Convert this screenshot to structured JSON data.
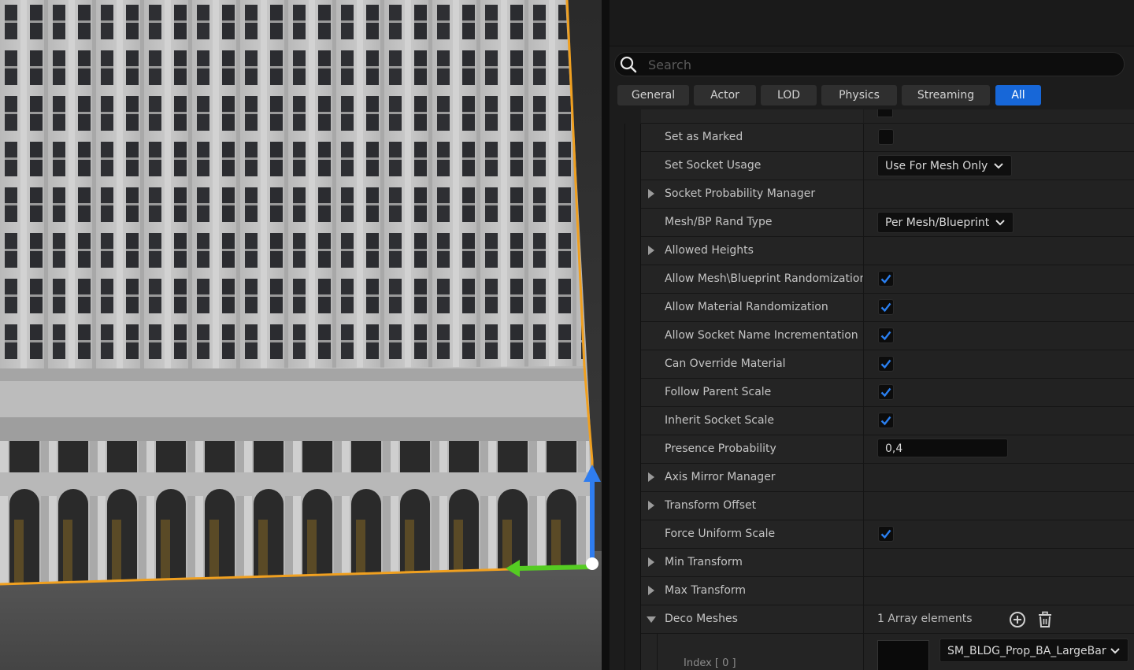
{
  "search": {
    "placeholder": "Search"
  },
  "tabs": [
    {
      "label": "General",
      "active": false
    },
    {
      "label": "Actor",
      "active": false
    },
    {
      "label": "LOD",
      "active": false
    },
    {
      "label": "Physics",
      "active": false
    },
    {
      "label": "Streaming",
      "active": false
    },
    {
      "label": "All",
      "active": true
    }
  ],
  "properties": {
    "set_as_marked": {
      "label": "Set as Marked",
      "checked": false
    },
    "set_socket_usage": {
      "label": "Set Socket Usage",
      "value": "Use For Mesh Only"
    },
    "socket_probability_manager": {
      "label": "Socket Probability Manager"
    },
    "mesh_bp_rand_type": {
      "label": "Mesh/BP Rand Type",
      "value": "Per Mesh/Blueprint"
    },
    "allowed_heights": {
      "label": "Allowed Heights"
    },
    "allow_mesh_bp_randomization": {
      "label": "Allow Mesh\\Blueprint Randomization",
      "checked": true
    },
    "allow_material_randomization": {
      "label": "Allow Material Randomization",
      "checked": true
    },
    "allow_socket_name_incrementation": {
      "label": "Allow Socket Name Incrementation",
      "checked": true
    },
    "can_override_material": {
      "label": "Can Override Material",
      "checked": true
    },
    "follow_parent_scale": {
      "label": "Follow Parent Scale",
      "checked": true
    },
    "inherit_socket_scale": {
      "label": "Inherit Socket Scale",
      "checked": true
    },
    "presence_probability": {
      "label": "Presence Probability",
      "value": "0,4"
    },
    "axis_mirror_manager": {
      "label": "Axis Mirror Manager"
    },
    "transform_offset": {
      "label": "Transform Offset"
    },
    "force_uniform_scale": {
      "label": "Force Uniform Scale",
      "checked": true
    },
    "min_transform": {
      "label": "Min Transform"
    },
    "max_transform": {
      "label": "Max Transform"
    },
    "deco_meshes": {
      "label": "Deco Meshes",
      "value": "1 Array elements"
    },
    "deco_mesh_0": {
      "index_label": "Index [ 0 ]",
      "value": "SM_BLDG_Prop_BA_LargeBar"
    }
  },
  "icons": {
    "search": "magnifier-icon",
    "add": "plus-circle-icon",
    "delete": "trash-icon",
    "dropdown": "chevron-down-icon",
    "expand": "triangle-right-icon",
    "collapse": "triangle-down-icon",
    "checkbox": "checkmark-icon"
  },
  "colors": {
    "accent": "#1767d8",
    "selection_outline": "#f0a020",
    "gizmo_z": "#2f7df0",
    "gizmo_y": "#55cc22",
    "panel_bg": "#1c1c1c"
  }
}
